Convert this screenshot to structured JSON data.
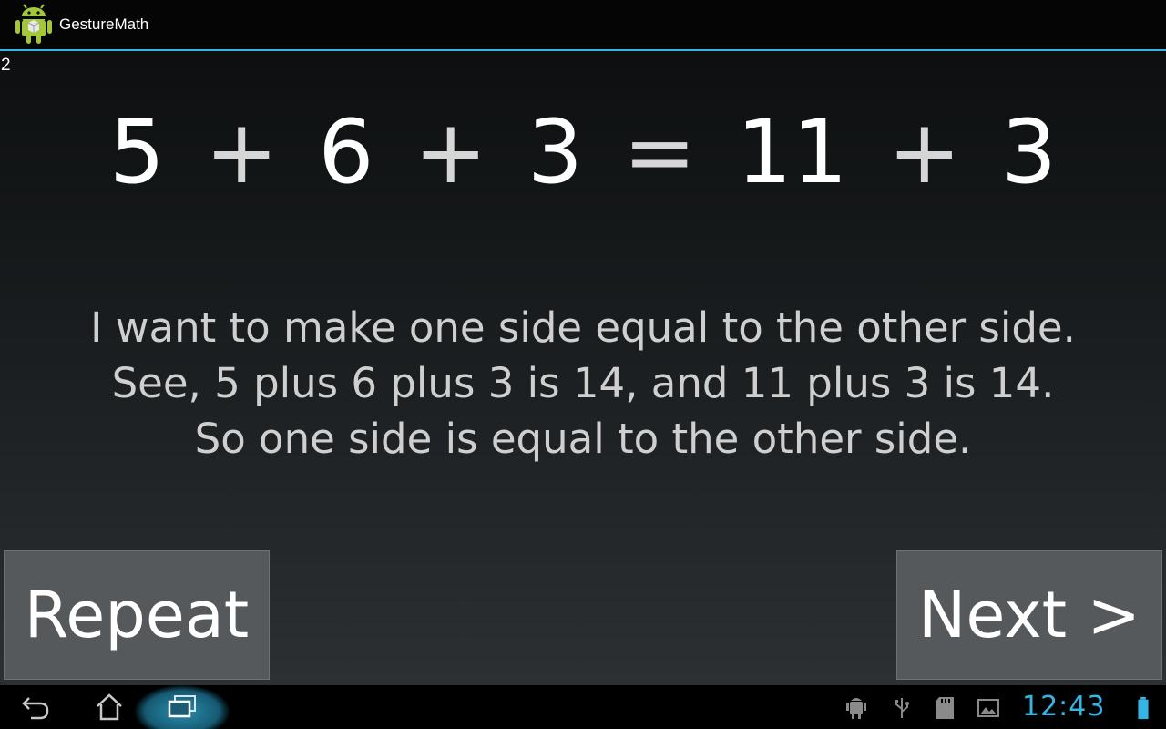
{
  "app": {
    "title": "GestureMath",
    "icon": "android-robot-icon"
  },
  "counter": "2",
  "equation": {
    "tokens": [
      "5",
      "+",
      "6",
      "+",
      "3",
      "=",
      "11",
      "+",
      "3"
    ]
  },
  "message": {
    "lines": [
      "I want to make one side equal to the other side.",
      "See, 5 plus 6 plus 3 is 14, and 11 plus 3 is 14.",
      "So one side is equal to the other side."
    ]
  },
  "buttons": {
    "repeat": "Repeat",
    "next": "Next >"
  },
  "navbar": {
    "icons": [
      "back-icon",
      "home-icon",
      "recent-apps-icon"
    ],
    "status_icons": [
      "android-debug-icon",
      "usb-icon",
      "sd-card-icon",
      "gallery-icon",
      "battery-icon"
    ],
    "clock": "12:43"
  },
  "colors": {
    "accent": "#33b5e5",
    "button": "#55595c",
    "text": "#ffffff"
  }
}
